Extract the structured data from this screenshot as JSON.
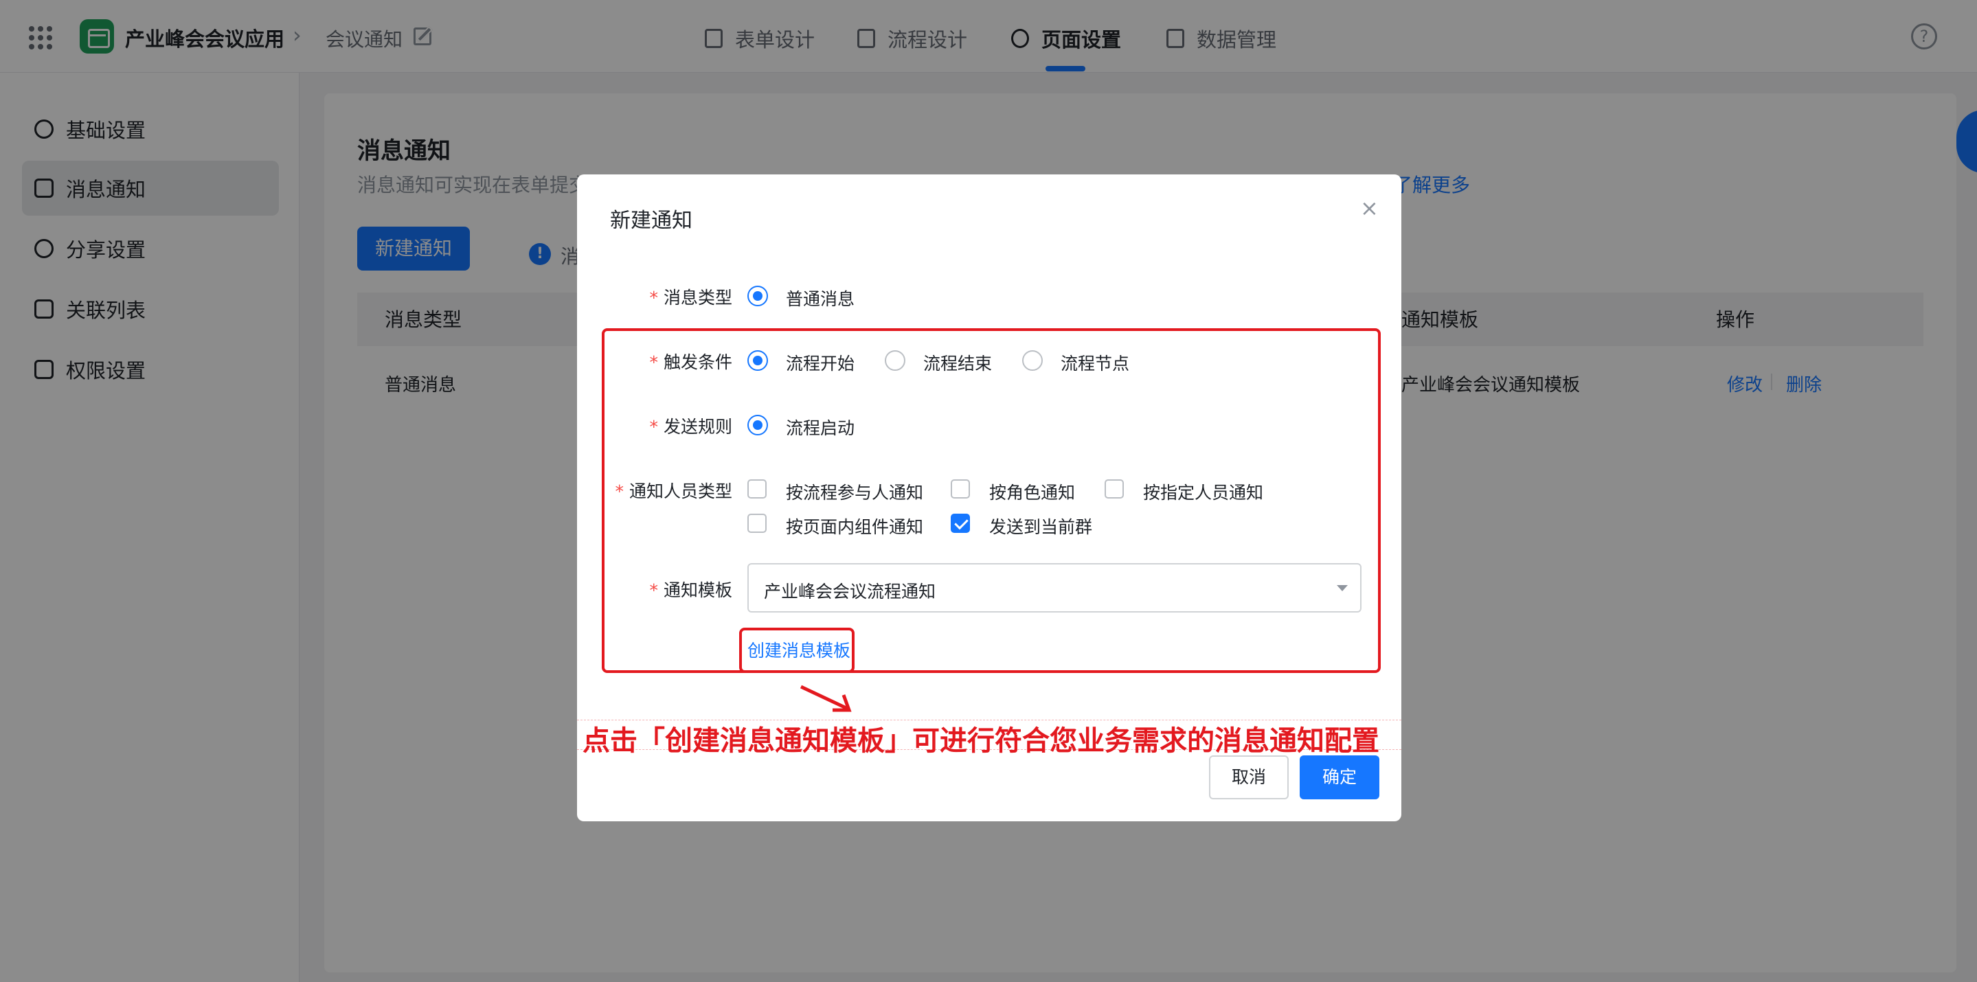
{
  "topbar": {
    "app_name": "产业峰会会议应用",
    "breadcrumb_sep": "›",
    "page_name": "会议通知",
    "tabs": [
      "表单设计",
      "流程设计",
      "页面设置",
      "数据管理"
    ],
    "help": "?"
  },
  "sidebar": {
    "items": [
      "基础设置",
      "消息通知",
      "分享设置",
      "关联列表",
      "权限设置"
    ]
  },
  "main": {
    "title": "消息通知",
    "desc": "消息通知可实现在表单提交",
    "learn_more": "了解更多",
    "new_button": "新建通知",
    "info_text": "消",
    "columns": {
      "type": "消息类型",
      "template": "通知模板",
      "action": "操作"
    },
    "row": {
      "type": "普通消息",
      "template": "产业峰会会议通知模板",
      "edit": "修改",
      "delete": "删除"
    }
  },
  "modal": {
    "title": "新建通知",
    "close": "×",
    "required_mark": "*",
    "labels": {
      "msg_type": "消息类型",
      "trigger": "触发条件",
      "send_rule": "发送规则",
      "recipient": "通知人员类型",
      "template": "通知模板"
    },
    "msg_type_option": "普通消息",
    "trigger_options": [
      "流程开始",
      "流程结束",
      "流程节点"
    ],
    "send_rule_option": "流程启动",
    "recipient_options": [
      "按流程参与人通知",
      "按角色通知",
      "按指定人员通知",
      "按页面内组件通知",
      "发送到当前群"
    ],
    "template_value": "产业峰会会议流程通知",
    "create_template_link": "创建消息模板",
    "cancel": "取消",
    "ok": "确定"
  },
  "annotation": {
    "text": "点击「创建消息通知模板」可进行符合您业务需求的消息通知配置",
    "color": "#e3191f"
  },
  "colors": {
    "primary": "#1677ff",
    "logo_green": "#1fa15c",
    "required": "#f54a45"
  }
}
